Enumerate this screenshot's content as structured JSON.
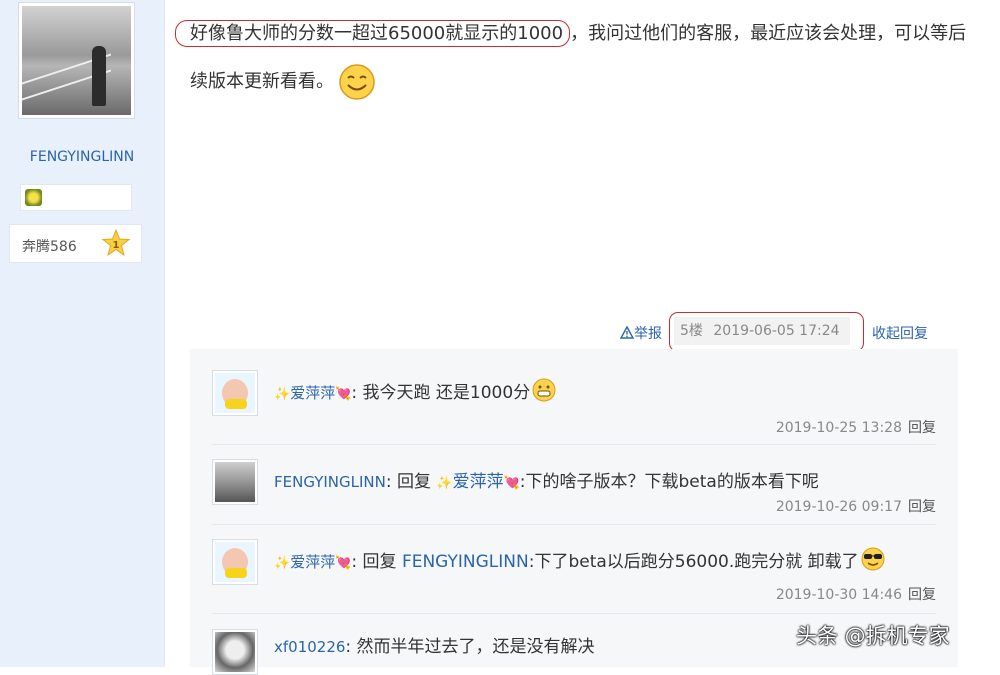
{
  "author": {
    "username": "FENGYINGLINN",
    "level_label": "奔腾586",
    "level_number": "1",
    "medal_icon": "medal-icon"
  },
  "post": {
    "highlighted_text": "好像鲁大师的分数一超过65000就显示的1000",
    "rest_text": "，我问过他们的客服，最近应该会处理，可以等后续版本更新看看。"
  },
  "meta": {
    "report_label": "举报",
    "floor_label": "5楼",
    "timestamp": "2019-06-05 17:24",
    "collapse_label": "收起回复"
  },
  "replies": [
    {
      "author": "爱萍萍",
      "content": ": 我今天跑 还是1000分",
      "time": "2019-10-25 13:28",
      "reply_label": "回复",
      "emoji": "grin-emoji"
    },
    {
      "author": "FENGYINGLINN",
      "reply_word": "回复",
      "target": "爱萍萍",
      "content": ":下的啥子版本？下载beta的版本看下呢",
      "time": "2019-10-26 09:17",
      "reply_label": "回复"
    },
    {
      "author": "爱萍萍",
      "reply_word": "回复",
      "target": "FENGYINGLINN",
      "content": ":下了beta以后跑分56000.跑完分就 卸载了",
      "time": "2019-10-30 14:46",
      "reply_label": "回复",
      "emoji": "sunglasses-emoji"
    },
    {
      "author": "xf010226",
      "content": ": 然而半年过去了，还是没有解决"
    }
  ],
  "watermark": "头条 @拆机专家",
  "colors": {
    "link": "#2b64ad",
    "highlight_border": "#c82d2d",
    "sidebar_bg": "#e8f1fb",
    "reply_bg": "#f5f7f9"
  }
}
